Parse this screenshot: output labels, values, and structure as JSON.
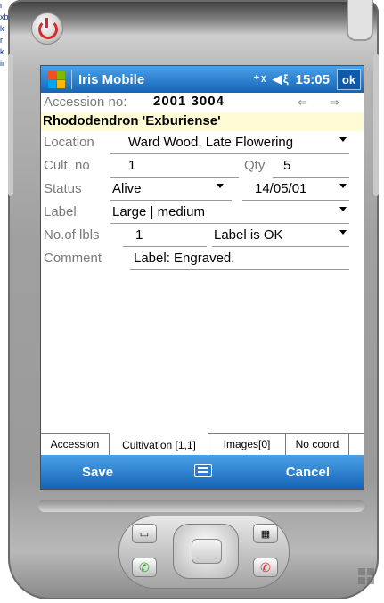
{
  "window": {
    "app_title": "Iris Mobile",
    "time": "15:05",
    "ok_label": "ok",
    "status_icons": "⁺ᵡ ◀ξ"
  },
  "accession": {
    "label": "Accession no:",
    "number": "2001 3004",
    "plant_name": "Rhododendron 'Exburiense'"
  },
  "fields": {
    "location": {
      "label": "Location",
      "value": "Ward Wood, Late Flowering"
    },
    "cult_no": {
      "label": "Cult. no",
      "value": "1"
    },
    "qty": {
      "label": "Qty",
      "value": "5"
    },
    "status": {
      "label": "Status",
      "value": "Alive"
    },
    "date": {
      "value": "14/05/01"
    },
    "label_size": {
      "label": "Label",
      "value": "Large | medium"
    },
    "no_of_labels": {
      "label": "No.of lbls",
      "value": "1"
    },
    "label_status": {
      "value": "Label is OK"
    },
    "comment": {
      "label": "Comment",
      "value": "Label: Engraved."
    }
  },
  "tabs": [
    "Accession",
    "Cultivation [1,1]",
    "Images[0]",
    "No coord"
  ],
  "softkeys": {
    "left": "Save",
    "right": "Cancel"
  },
  "background_text": [
    "r",
    "xb",
    "k",
    "r",
    "k",
    "ir"
  ],
  "colors": {
    "titlebar": "#1f6fc4",
    "highlight": "#fffbd4",
    "power": "#d42b2b",
    "call_green": "#2a9a2a",
    "call_red": "#d42b2b"
  }
}
